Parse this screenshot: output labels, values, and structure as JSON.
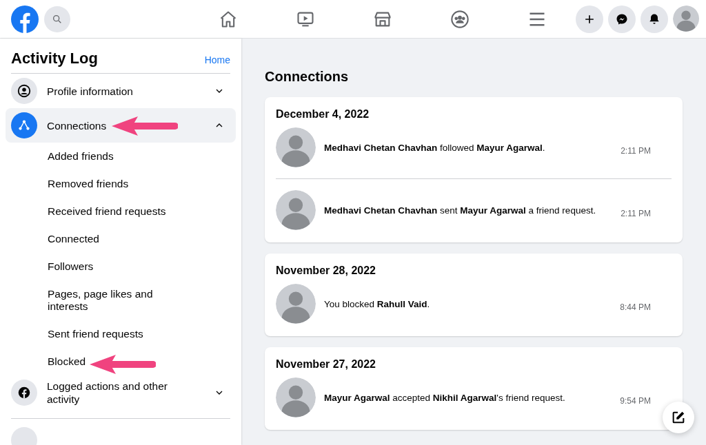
{
  "top_bar": {
    "nav": [
      {
        "kind": "home"
      },
      {
        "kind": "video"
      },
      {
        "kind": "store"
      },
      {
        "kind": "groups"
      },
      {
        "kind": "menu"
      }
    ],
    "actions": [
      {
        "kind": "plus"
      },
      {
        "kind": "messenger"
      },
      {
        "kind": "bell"
      }
    ]
  },
  "sidebar": {
    "title": "Activity Log",
    "home_link": "Home",
    "sections": [
      {
        "label": "Profile information",
        "kind": "profile",
        "expanded": false,
        "selected": false
      },
      {
        "label": "Connections",
        "kind": "connections",
        "expanded": true,
        "selected": true,
        "children": [
          {
            "label": "Added friends"
          },
          {
            "label": "Removed friends"
          },
          {
            "label": "Received friend requests"
          },
          {
            "label": "Connected"
          },
          {
            "label": "Followers"
          },
          {
            "label": "Pages, page likes and interests"
          },
          {
            "label": "Sent friend requests"
          },
          {
            "label": "Blocked"
          }
        ]
      },
      {
        "label": "Logged actions and other activity",
        "kind": "logged",
        "expanded": false,
        "selected": false
      }
    ]
  },
  "main": {
    "heading": "Connections",
    "groups": [
      {
        "date": "December 4, 2022",
        "entries": [
          {
            "text": "**Medhavi Chetan Chavhan** followed **Mayur Agarwal**.",
            "time": "2:11 PM"
          },
          {
            "text": "**Medhavi Chetan Chavhan** sent **Mayur Agarwal** a friend request.",
            "time": "2:11 PM"
          }
        ]
      },
      {
        "date": "November 28, 2022",
        "entries": [
          {
            "text": "You blocked **Rahull Vaid**.",
            "time": "8:44 PM"
          }
        ]
      },
      {
        "date": "November 27, 2022",
        "entries": [
          {
            "text": "**Mayur Agarwal** accepted **Nikhil Agarwal**'s friend request.",
            "time": "9:54 PM"
          }
        ]
      }
    ]
  }
}
